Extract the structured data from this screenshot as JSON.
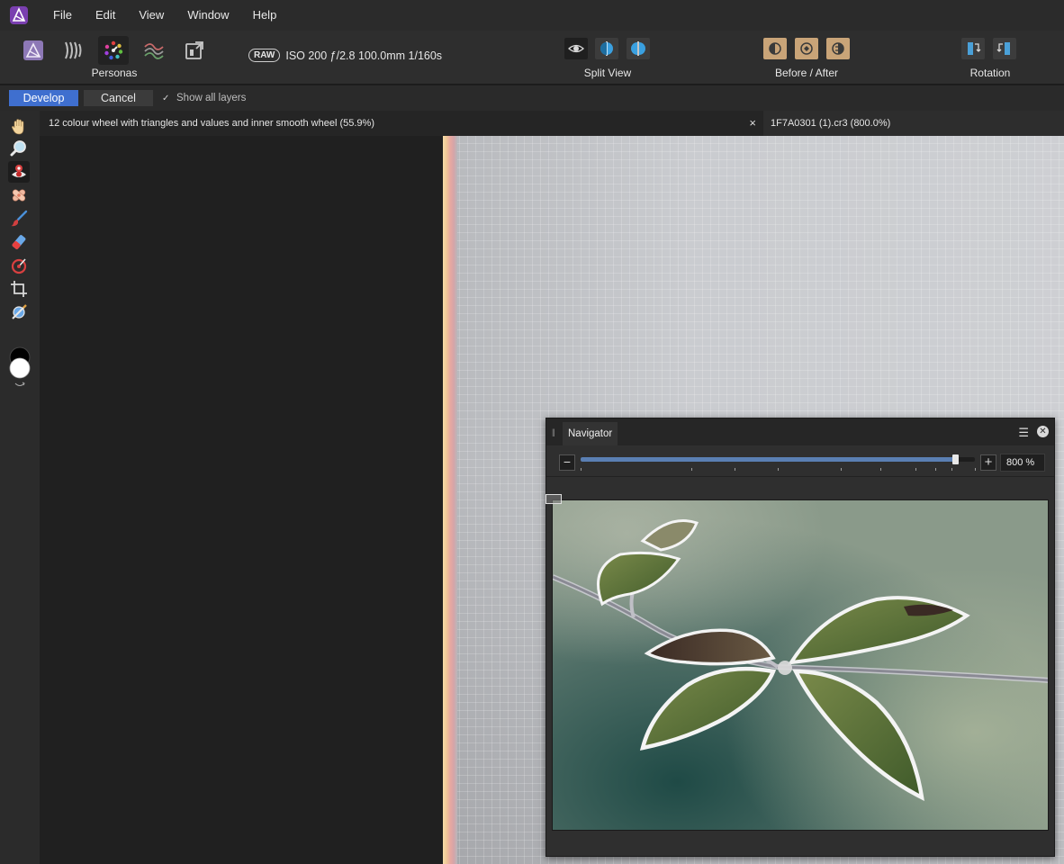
{
  "menubar": {
    "items": [
      "File",
      "Edit",
      "View",
      "Window",
      "Help"
    ]
  },
  "toolbar": {
    "personas_label": "Personas",
    "raw_badge": "RAW",
    "exif": "ISO 200 ƒ/2.8 100.0mm 1/160s",
    "split_view_label": "Split View",
    "before_after_label": "Before / After",
    "rotation_label": "Rotation"
  },
  "context": {
    "develop_label": "Develop",
    "cancel_label": "Cancel",
    "show_layers_label": "Show all layers",
    "show_layers_checked": true
  },
  "tools": [
    "hand-icon",
    "zoom-icon",
    "red-eye-icon",
    "blemish-icon",
    "brush-icon",
    "eraser-icon",
    "gradient-icon",
    "crop-icon",
    "white-balance-icon"
  ],
  "tabs": {
    "tab1": "12 colour wheel with triangles and values and inner smooth wheel (55.9%)",
    "tab1_close": "×",
    "tab2": "1F7A0301 (1).cr3 (800.0%)"
  },
  "navigator": {
    "title": "Navigator",
    "zoom_value": "800 %",
    "zoom_fraction": 0.95
  },
  "colors": {
    "accent": "#3f6fcf",
    "slider_fill": "#5a7fb3",
    "before_after": "#c9a478"
  }
}
